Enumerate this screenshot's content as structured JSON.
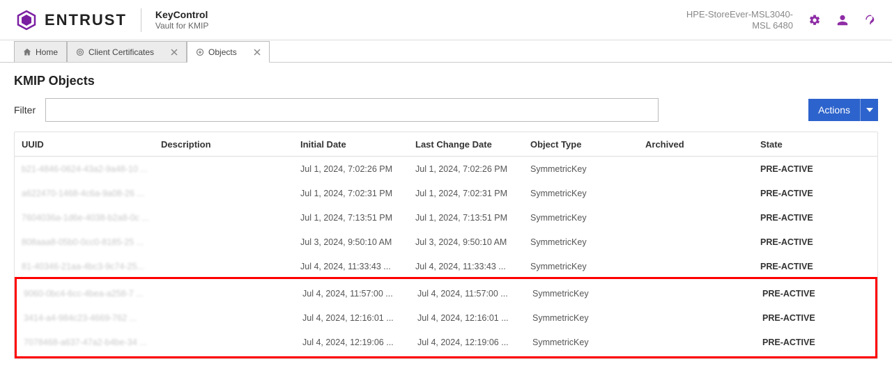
{
  "header": {
    "brand": "ENTRUST",
    "product_main": "KeyControl",
    "product_sub": "Vault for KMIP",
    "tenant": "HPE-StoreEver-MSL3040-MSL 6480"
  },
  "tabs": [
    {
      "label": "Home",
      "closable": false,
      "active": false,
      "icon": "home"
    },
    {
      "label": "Client Certificates",
      "closable": true,
      "active": false,
      "icon": "cert"
    },
    {
      "label": "Objects",
      "closable": true,
      "active": true,
      "icon": "obj"
    }
  ],
  "page": {
    "title": "KMIP Objects",
    "filter_label": "Filter",
    "filter_value": "",
    "actions_label": "Actions"
  },
  "columns": {
    "uuid": "UUID",
    "description": "Description",
    "initial_date": "Initial Date",
    "last_change_date": "Last Change Date",
    "object_type": "Object Type",
    "archived": "Archived",
    "state": "State"
  },
  "rows": [
    {
      "uuid": "b21-4846-0624-43a2-9a48-10 ...",
      "description": "",
      "initial_date": "Jul 1, 2024, 7:02:26 PM",
      "last_change_date": "Jul 1, 2024, 7:02:26 PM",
      "object_type": "SymmetricKey",
      "archived": "",
      "state": "PRE-ACTIVE"
    },
    {
      "uuid": "a622470-1468-4c6a-9a08-26 ...",
      "description": "",
      "initial_date": "Jul 1, 2024, 7:02:31 PM",
      "last_change_date": "Jul 1, 2024, 7:02:31 PM",
      "object_type": "SymmetricKey",
      "archived": "",
      "state": "PRE-ACTIVE"
    },
    {
      "uuid": "7604036a-1d6e-4038-b2a8-0c ...",
      "description": "",
      "initial_date": "Jul 1, 2024, 7:13:51 PM",
      "last_change_date": "Jul 1, 2024, 7:13:51 PM",
      "object_type": "SymmetricKey",
      "archived": "",
      "state": "PRE-ACTIVE"
    },
    {
      "uuid": "808aaa8-05b0-0cc0-8185-25 ...",
      "description": "",
      "initial_date": "Jul 3, 2024, 9:50:10 AM",
      "last_change_date": "Jul 3, 2024, 9:50:10 AM",
      "object_type": "SymmetricKey",
      "archived": "",
      "state": "PRE-ACTIVE"
    },
    {
      "uuid": "81-40346-21aa-4bc3-9c74-25...",
      "description": "",
      "initial_date": "Jul 4, 2024, 11:33:43 ...",
      "last_change_date": "Jul 4, 2024, 11:33:43 ...",
      "object_type": "SymmetricKey",
      "archived": "",
      "state": "PRE-ACTIVE"
    },
    {
      "uuid": "9060-0bc4-6cc-4bea-a258-7 ...",
      "description": "",
      "initial_date": "Jul 4, 2024, 11:57:00 ...",
      "last_change_date": "Jul 4, 2024, 11:57:00 ...",
      "object_type": "SymmetricKey",
      "archived": "",
      "state": "PRE-ACTIVE"
    },
    {
      "uuid": "3414-a4-984c23-4669-762 ...",
      "description": "",
      "initial_date": "Jul 4, 2024, 12:16:01 ...",
      "last_change_date": "Jul 4, 2024, 12:16:01 ...",
      "object_type": "SymmetricKey",
      "archived": "",
      "state": "PRE-ACTIVE"
    },
    {
      "uuid": "7078468-a637-47a2-b4be-34 ...",
      "description": "",
      "initial_date": "Jul 4, 2024, 12:19:06 ...",
      "last_change_date": "Jul 4, 2024, 12:19:06 ...",
      "object_type": "SymmetricKey",
      "archived": "",
      "state": "PRE-ACTIVE"
    }
  ]
}
